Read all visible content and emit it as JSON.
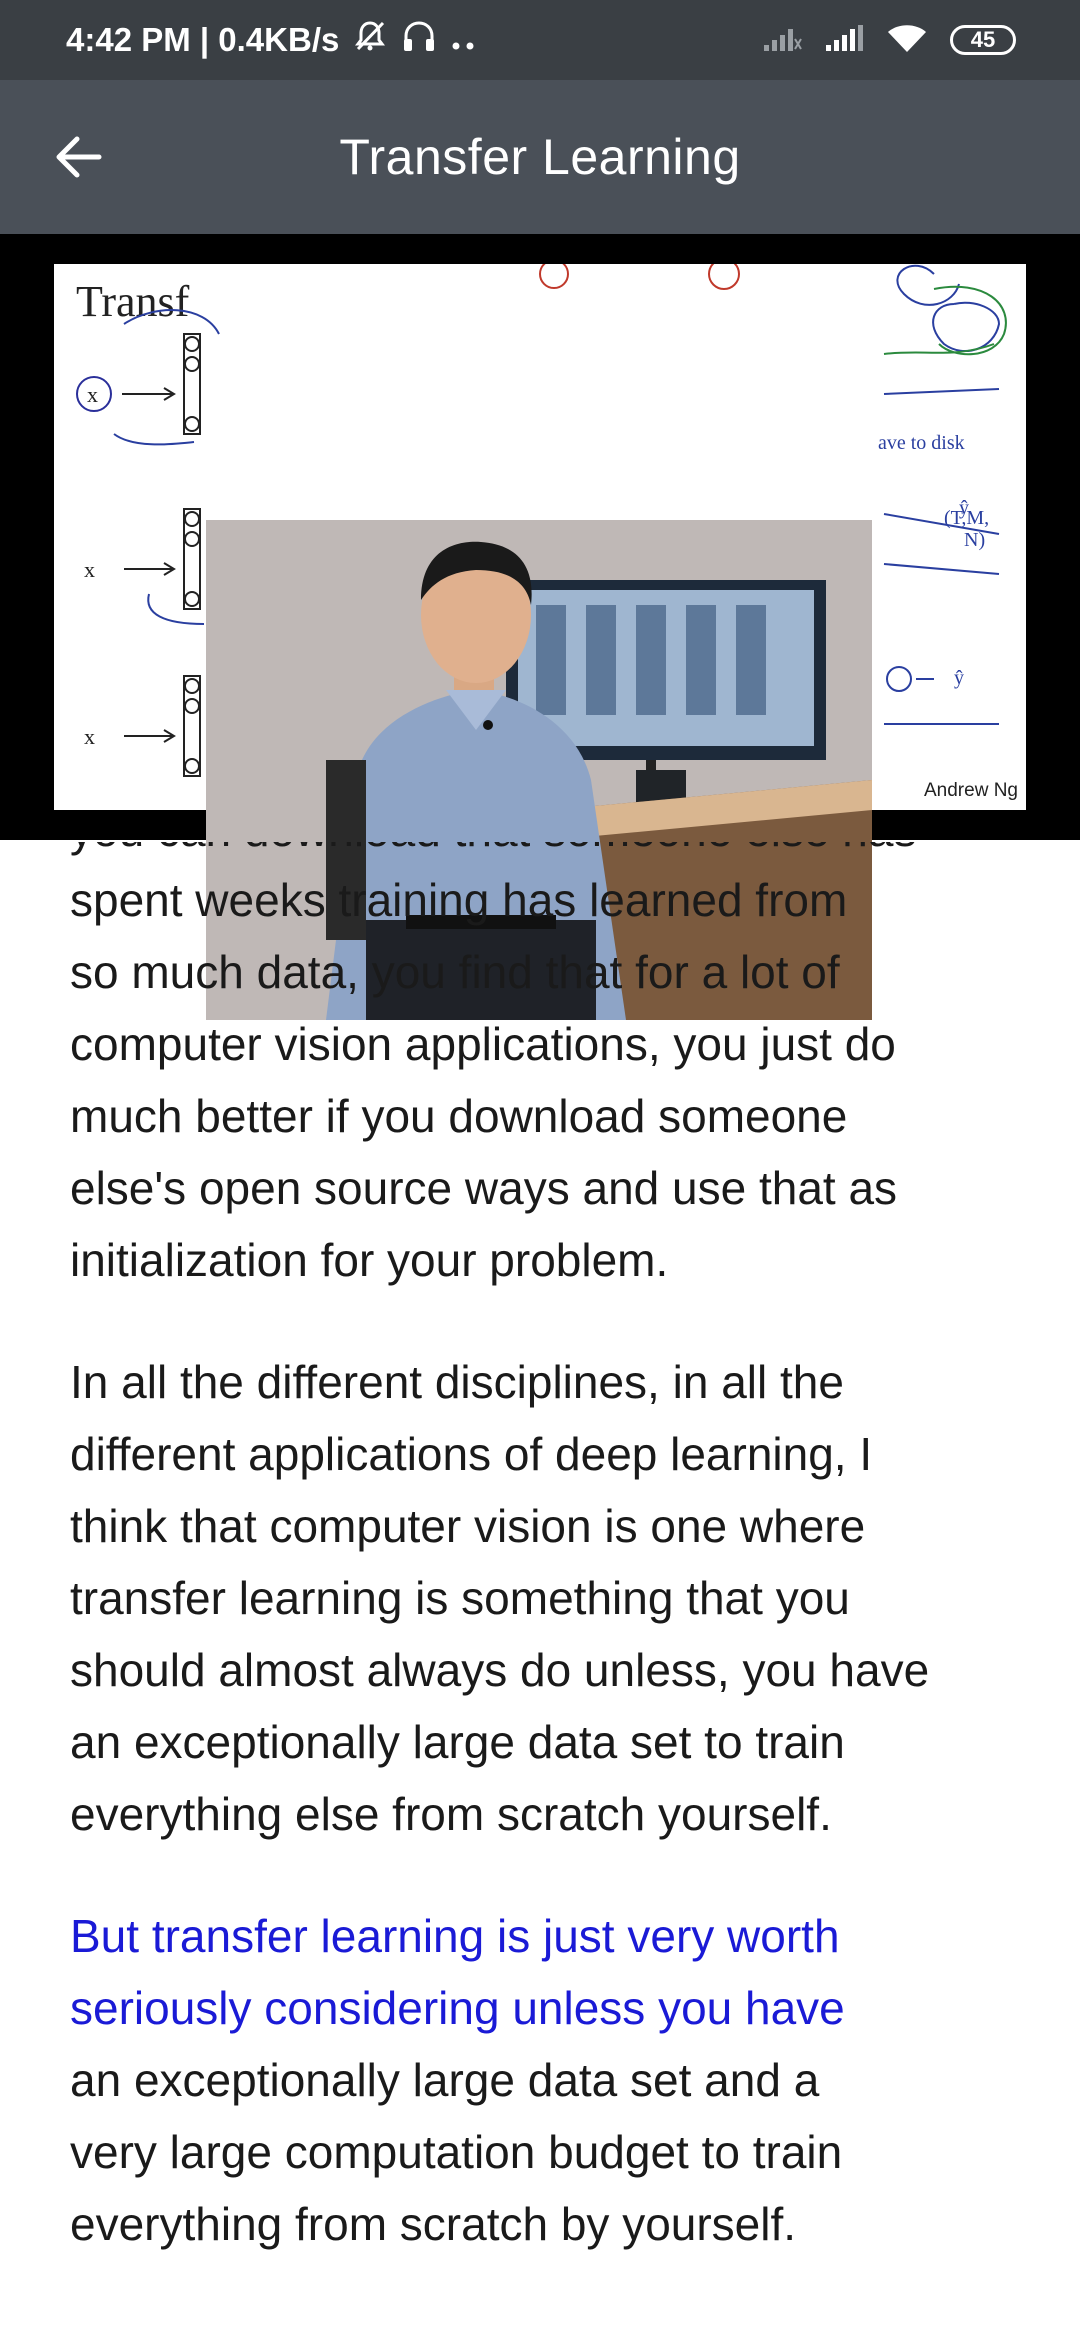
{
  "status_bar": {
    "time_speed": "4:42 PM | 0.4KB/s",
    "battery": "45",
    "icons": [
      "mute-icon",
      "headset-icon",
      "more-dots-icon",
      "signal-icon",
      "wifi-icon",
      "battery-icon"
    ]
  },
  "app_bar": {
    "title": "Transfer Learning",
    "back_icon": "arrow-left-icon"
  },
  "video": {
    "slide_title": "Transf",
    "slide_credit": "Andrew Ng"
  },
  "article": {
    "cut_line": "you can download that someone else has",
    "paragraphs": [
      {
        "lines": [
          "spent weeks training has learned from",
          "so much data, you find that for a lot of",
          "computer vision applications, you just do",
          "much better if you download someone",
          "else's open source ways and use that as",
          "initialization for your problem."
        ]
      },
      {
        "lines": [
          "In all the different disciplines, in all the",
          "different applications of deep learning, I",
          "think that computer vision is one where",
          "transfer learning is something that you",
          "should almost always do unless, you have",
          "an exceptionally large data set to train",
          "everything else from scratch yourself."
        ]
      },
      {
        "highlight_lines": [
          "But transfer learning is just very worth",
          "seriously considering unless you have"
        ],
        "lines": [
          "an exceptionally large data set and a",
          "very large computation budget to train",
          "everything from scratch by yourself."
        ]
      }
    ]
  },
  "colors": {
    "status_bar_bg": "#3a3f44",
    "app_bar_bg": "#4a5058",
    "highlight_text": "#1a1ad6",
    "body_text": "#1a1a1a"
  }
}
